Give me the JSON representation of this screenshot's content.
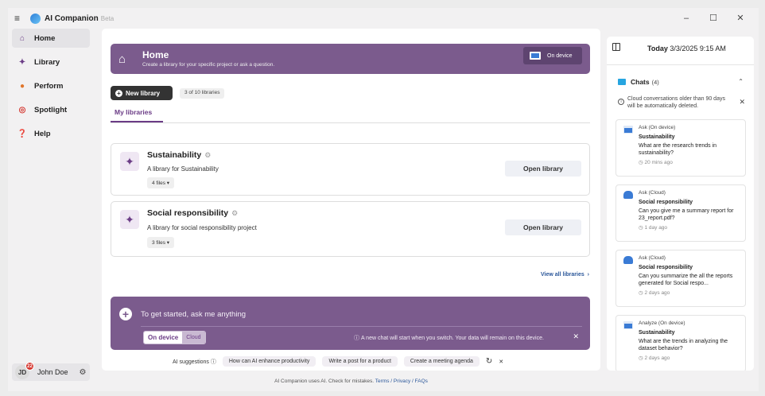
{
  "app": {
    "title": "AI Companion",
    "badge": "Beta"
  },
  "window_controls": {
    "minimize": "–",
    "maximize": "☐",
    "close": "✕"
  },
  "sidebar": {
    "items": [
      {
        "label": "Home",
        "icon": "home-icon",
        "glyph": "⌂",
        "color": "#6b3c86"
      },
      {
        "label": "Library",
        "icon": "sparkle-icon",
        "glyph": "✦",
        "color": "#6b3c86"
      },
      {
        "label": "Perform",
        "icon": "perform-icon",
        "glyph": "●",
        "color": "#e0762b"
      },
      {
        "label": "Spotlight",
        "icon": "spotlight-icon",
        "glyph": "◎",
        "color": "#d4352e"
      },
      {
        "label": "Help",
        "icon": "help-icon",
        "glyph": "❓",
        "color": "#222"
      }
    ],
    "user": {
      "initials": "JD",
      "notifications": "22",
      "name": "John Doe"
    }
  },
  "hero": {
    "title": "Home",
    "subtitle": "Create a library for your specific project or ask a question.",
    "device_label": "On device"
  },
  "toolbar": {
    "new_library": "New library",
    "library_count": "3 of 10 libraries"
  },
  "tabs": {
    "my_libraries": "My libraries"
  },
  "libraries": [
    {
      "title": "Sustainability",
      "description": "A library for Sustainability",
      "files": "4 files",
      "open": "Open library"
    },
    {
      "title": "Social responsibility",
      "description": "A library for social responsibility project",
      "files": "3 files",
      "open": "Open library"
    }
  ],
  "view_all": "View all libraries",
  "ask": {
    "placeholder": "To get started, ask me anything",
    "mode_on": "On device",
    "mode_off": "Cloud",
    "note": "A new chat will start when you switch. Your data will remain on this device."
  },
  "suggestions": {
    "label": "AI suggestions",
    "chips": [
      "How can AI enhance productivity",
      "Write a post for a product",
      "Create a meeting agenda"
    ]
  },
  "footer": {
    "text": "AI Companion uses AI. Check for mistakes.",
    "links": "Terms / Privacy / FAQs"
  },
  "panel": {
    "date_label": "Today",
    "date_value": "3/3/2025 9:15 AM",
    "chats_label": "Chats",
    "chats_count": "(4)",
    "notice": "Cloud conversations older than 90 days will be automatically deleted.",
    "chats": [
      {
        "type": "Ask (On device)",
        "mode": "device",
        "title": "Sustainability",
        "question": "What are the research trends in sustainability?",
        "time": "20 mins ago"
      },
      {
        "type": "Ask (Cloud)",
        "mode": "cloud",
        "title": "Social responsibility",
        "question": "Can you give me a summary report for 23_report.pdf?",
        "time": "1 day ago"
      },
      {
        "type": "Ask (Cloud)",
        "mode": "cloud",
        "title": "Social responsibility",
        "question": "Can you summarize the all the reports generated for Social respo...",
        "time": "2 days ago"
      },
      {
        "type": "Analyze (On device)",
        "mode": "device",
        "title": "Sustainability",
        "question": "What are the trends in analyzing the dataset behavior?",
        "time": "2 days ago"
      }
    ]
  }
}
